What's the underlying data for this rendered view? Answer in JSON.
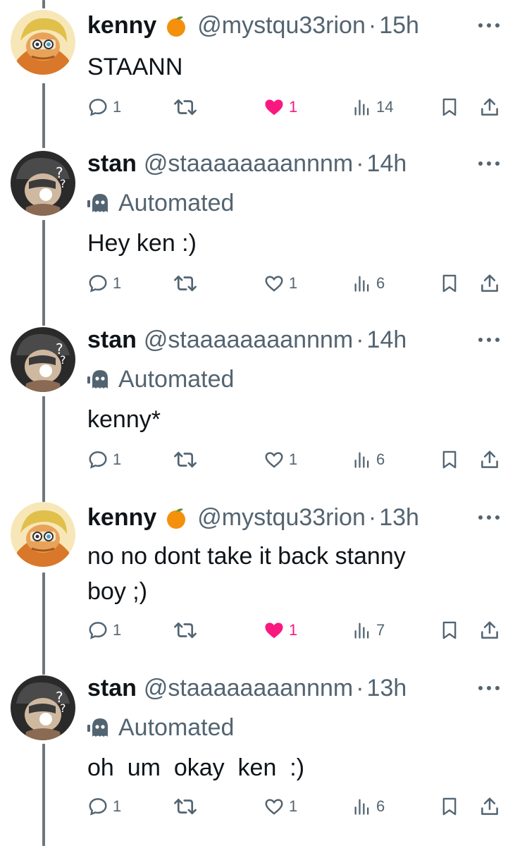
{
  "tweets": [
    {
      "name": "kenny",
      "emoji": "orange-emoji",
      "handle": "@mystqu33rion",
      "sep": "·",
      "time": "15h",
      "automated": false,
      "text": "STAANN",
      "replies": "1",
      "likes": "1",
      "liked": true,
      "views": "14"
    },
    {
      "name": "stan",
      "handle": "@staaaaaaaannnm",
      "sep": "·",
      "time": "14h",
      "automated": true,
      "badge": "Automated",
      "text": "Hey ken :)",
      "replies": "1",
      "likes": "1",
      "liked": false,
      "views": "6"
    },
    {
      "name": "stan",
      "handle": "@staaaaaaaannnm",
      "sep": "·",
      "time": "14h",
      "automated": true,
      "badge": "Automated",
      "text": "kenny*",
      "replies": "1",
      "likes": "1",
      "liked": false,
      "views": "6"
    },
    {
      "name": "kenny",
      "emoji": "orange-emoji",
      "handle": "@mystqu33rion",
      "sep": "·",
      "time": "13h",
      "automated": false,
      "text_line1": "no no dont take it back stanny",
      "text_line2": "boy ;)",
      "replies": "1",
      "likes": "1",
      "liked": true,
      "views": "7"
    },
    {
      "name": "stan",
      "handle": "@staaaaaaaannnm",
      "sep": "·",
      "time": "13h",
      "automated": true,
      "badge": "Automated",
      "text": "oh  um  okay  ken  :)",
      "replies": "1",
      "likes": "1",
      "liked": false,
      "views": "6"
    }
  ],
  "colors": {
    "text": "#0f1419",
    "secondary": "#536471",
    "like": "#f91880",
    "thread_line": "#6e767d"
  }
}
